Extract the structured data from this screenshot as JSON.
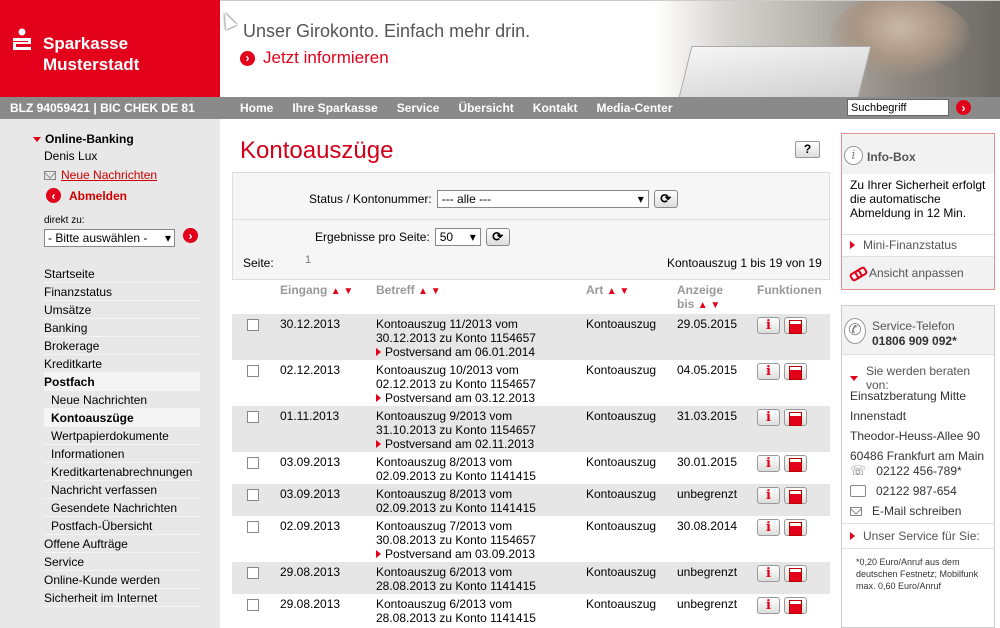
{
  "header": {
    "brand_line1": "Sparkasse",
    "brand_line2": "Musterstadt",
    "banner_title": "Unser Girokonto. Einfach mehr drin.",
    "banner_link": "Jetzt informieren"
  },
  "navbar": {
    "blz": "BLZ 94059421 | BIC CHEK DE 81",
    "items": [
      "Home",
      "Ihre Sparkasse",
      "Service",
      "Übersicht",
      "Kontakt",
      "Media-Center"
    ],
    "search_placeholder": "Suchbegriff"
  },
  "sidebar": {
    "section": "Online-Banking",
    "user": "Denis Lux",
    "messages": "Neue Nachrichten",
    "logout": "Abmelden",
    "direct_label": "direkt zu:",
    "direct_value": "- Bitte auswählen -",
    "menu": [
      {
        "label": "Startseite",
        "level": 0
      },
      {
        "label": "Finanzstatus",
        "level": 0
      },
      {
        "label": "Umsätze",
        "level": 0
      },
      {
        "label": "Banking",
        "level": 0
      },
      {
        "label": "Brokerage",
        "level": 0
      },
      {
        "label": "Kreditkarte",
        "level": 0
      },
      {
        "label": "Postfach",
        "level": 0
      },
      {
        "label": "Neue Nachrichten",
        "level": 1
      },
      {
        "label": "Kontoauszüge",
        "level": 1
      },
      {
        "label": "Wertpapierdokumente",
        "level": 1
      },
      {
        "label": "Informationen",
        "level": 1
      },
      {
        "label": "Kreditkartenabrechnungen",
        "level": 1
      },
      {
        "label": "Nachricht verfassen",
        "level": 1
      },
      {
        "label": "Gesendete Nachrichten",
        "level": 1
      },
      {
        "label": "Postfach-Übersicht",
        "level": 1
      },
      {
        "label": "Offene Aufträge",
        "level": 0
      },
      {
        "label": "Service",
        "level": 0
      },
      {
        "label": "Online-Kunde werden",
        "level": 0
      },
      {
        "label": "Sicherheit im Internet",
        "level": 0
      }
    ]
  },
  "main": {
    "title": "Kontoauszüge",
    "help": "?",
    "status_label": "Status / Kontonummer:",
    "status_value": "--- alle ---",
    "per_page_label": "Ergebnisse pro Seite:",
    "per_page_value": "50",
    "page_label": "Seite:",
    "page_number": "1",
    "count": "Kontoauszug 1 bis 19 von 19",
    "columns": {
      "eingang": "Eingang",
      "betreff": "Betreff",
      "art": "Art",
      "anzeige1": "Anzeige",
      "anzeige2": "bis",
      "funktionen": "Funktionen"
    },
    "rows": [
      {
        "date": "30.12.2013",
        "subj1": "Kontoauszug 11/2013 vom",
        "subj2": "30.12.2013 zu Konto 1154657",
        "post": "Postversand am 06.01.2014",
        "art": "Kontoauszug",
        "until": "29.05.2015"
      },
      {
        "date": "02.12.2013",
        "subj1": "Kontoauszug 10/2013 vom",
        "subj2": "02.12.2013 zu Konto 1154657",
        "post": "Postversand am 03.12.2013",
        "art": "Kontoauszug",
        "until": "04.05.2015"
      },
      {
        "date": "01.11.2013",
        "subj1": "Kontoauszug 9/2013 vom",
        "subj2": "31.10.2013 zu Konto 1154657",
        "post": "Postversand am 02.11.2013",
        "art": "Kontoauszug",
        "until": "31.03.2015"
      },
      {
        "date": "03.09.2013",
        "subj1": "Kontoauszug 8/2013 vom",
        "subj2": "02.09.2013 zu Konto 1141415",
        "post": "",
        "art": "Kontoauszug",
        "until": "30.01.2015"
      },
      {
        "date": "03.09.2013",
        "subj1": "Kontoauszug 8/2013 vom",
        "subj2": "02.09.2013 zu Konto 1141415",
        "post": "",
        "art": "Kontoauszug",
        "until": "unbegrenzt"
      },
      {
        "date": "02.09.2013",
        "subj1": "Kontoauszug 7/2013 vom",
        "subj2": "30.08.2013 zu Konto 1154657",
        "post": "Postversand am 03.09.2013",
        "art": "Kontoauszug",
        "until": "30.08.2014"
      },
      {
        "date": "29.08.2013",
        "subj1": "Kontoauszug 6/2013 vom",
        "subj2": "28.08.2013 zu Konto 1141415",
        "post": "",
        "art": "Kontoauszug",
        "until": "unbegrenzt"
      },
      {
        "date": "29.08.2013",
        "subj1": "Kontoauszug 6/2013 vom",
        "subj2": "28.08.2013 zu Konto 1141415",
        "post": "",
        "art": "Kontoauszug",
        "until": "unbegrenzt"
      }
    ]
  },
  "infobox": {
    "title": "Info-Box",
    "text": "Zu Ihrer Sicherheit erfolgt die automatische Abmeldung in 12 Min.",
    "mini": "Mini-Finanzstatus",
    "ansicht": "Ansicht anpassen"
  },
  "service": {
    "title": "Service-Telefon",
    "phone": "01806 909 092*",
    "beraten": "Sie werden beraten von:",
    "addr1": "Einsatzberatung Mitte",
    "addr2": "Innenstadt",
    "addr3": "Theodor-Heuss-Allee 90",
    "addr4": "60486 Frankfurt am Main",
    "tel": "02122 456-789*",
    "fax": "02122 987-654",
    "email": "E-Mail schreiben",
    "unser": "Unser Service für Sie:",
    "fine": "*0,20 Euro/Anruf aus dem deutschen Festnetz; Mobilfunk max. 0,60 Euro/Anruf"
  },
  "colors": {
    "brand_red": "#e2001a",
    "nav_gray": "#8a8a8a",
    "sidebar_gray": "#e8e8e8"
  }
}
